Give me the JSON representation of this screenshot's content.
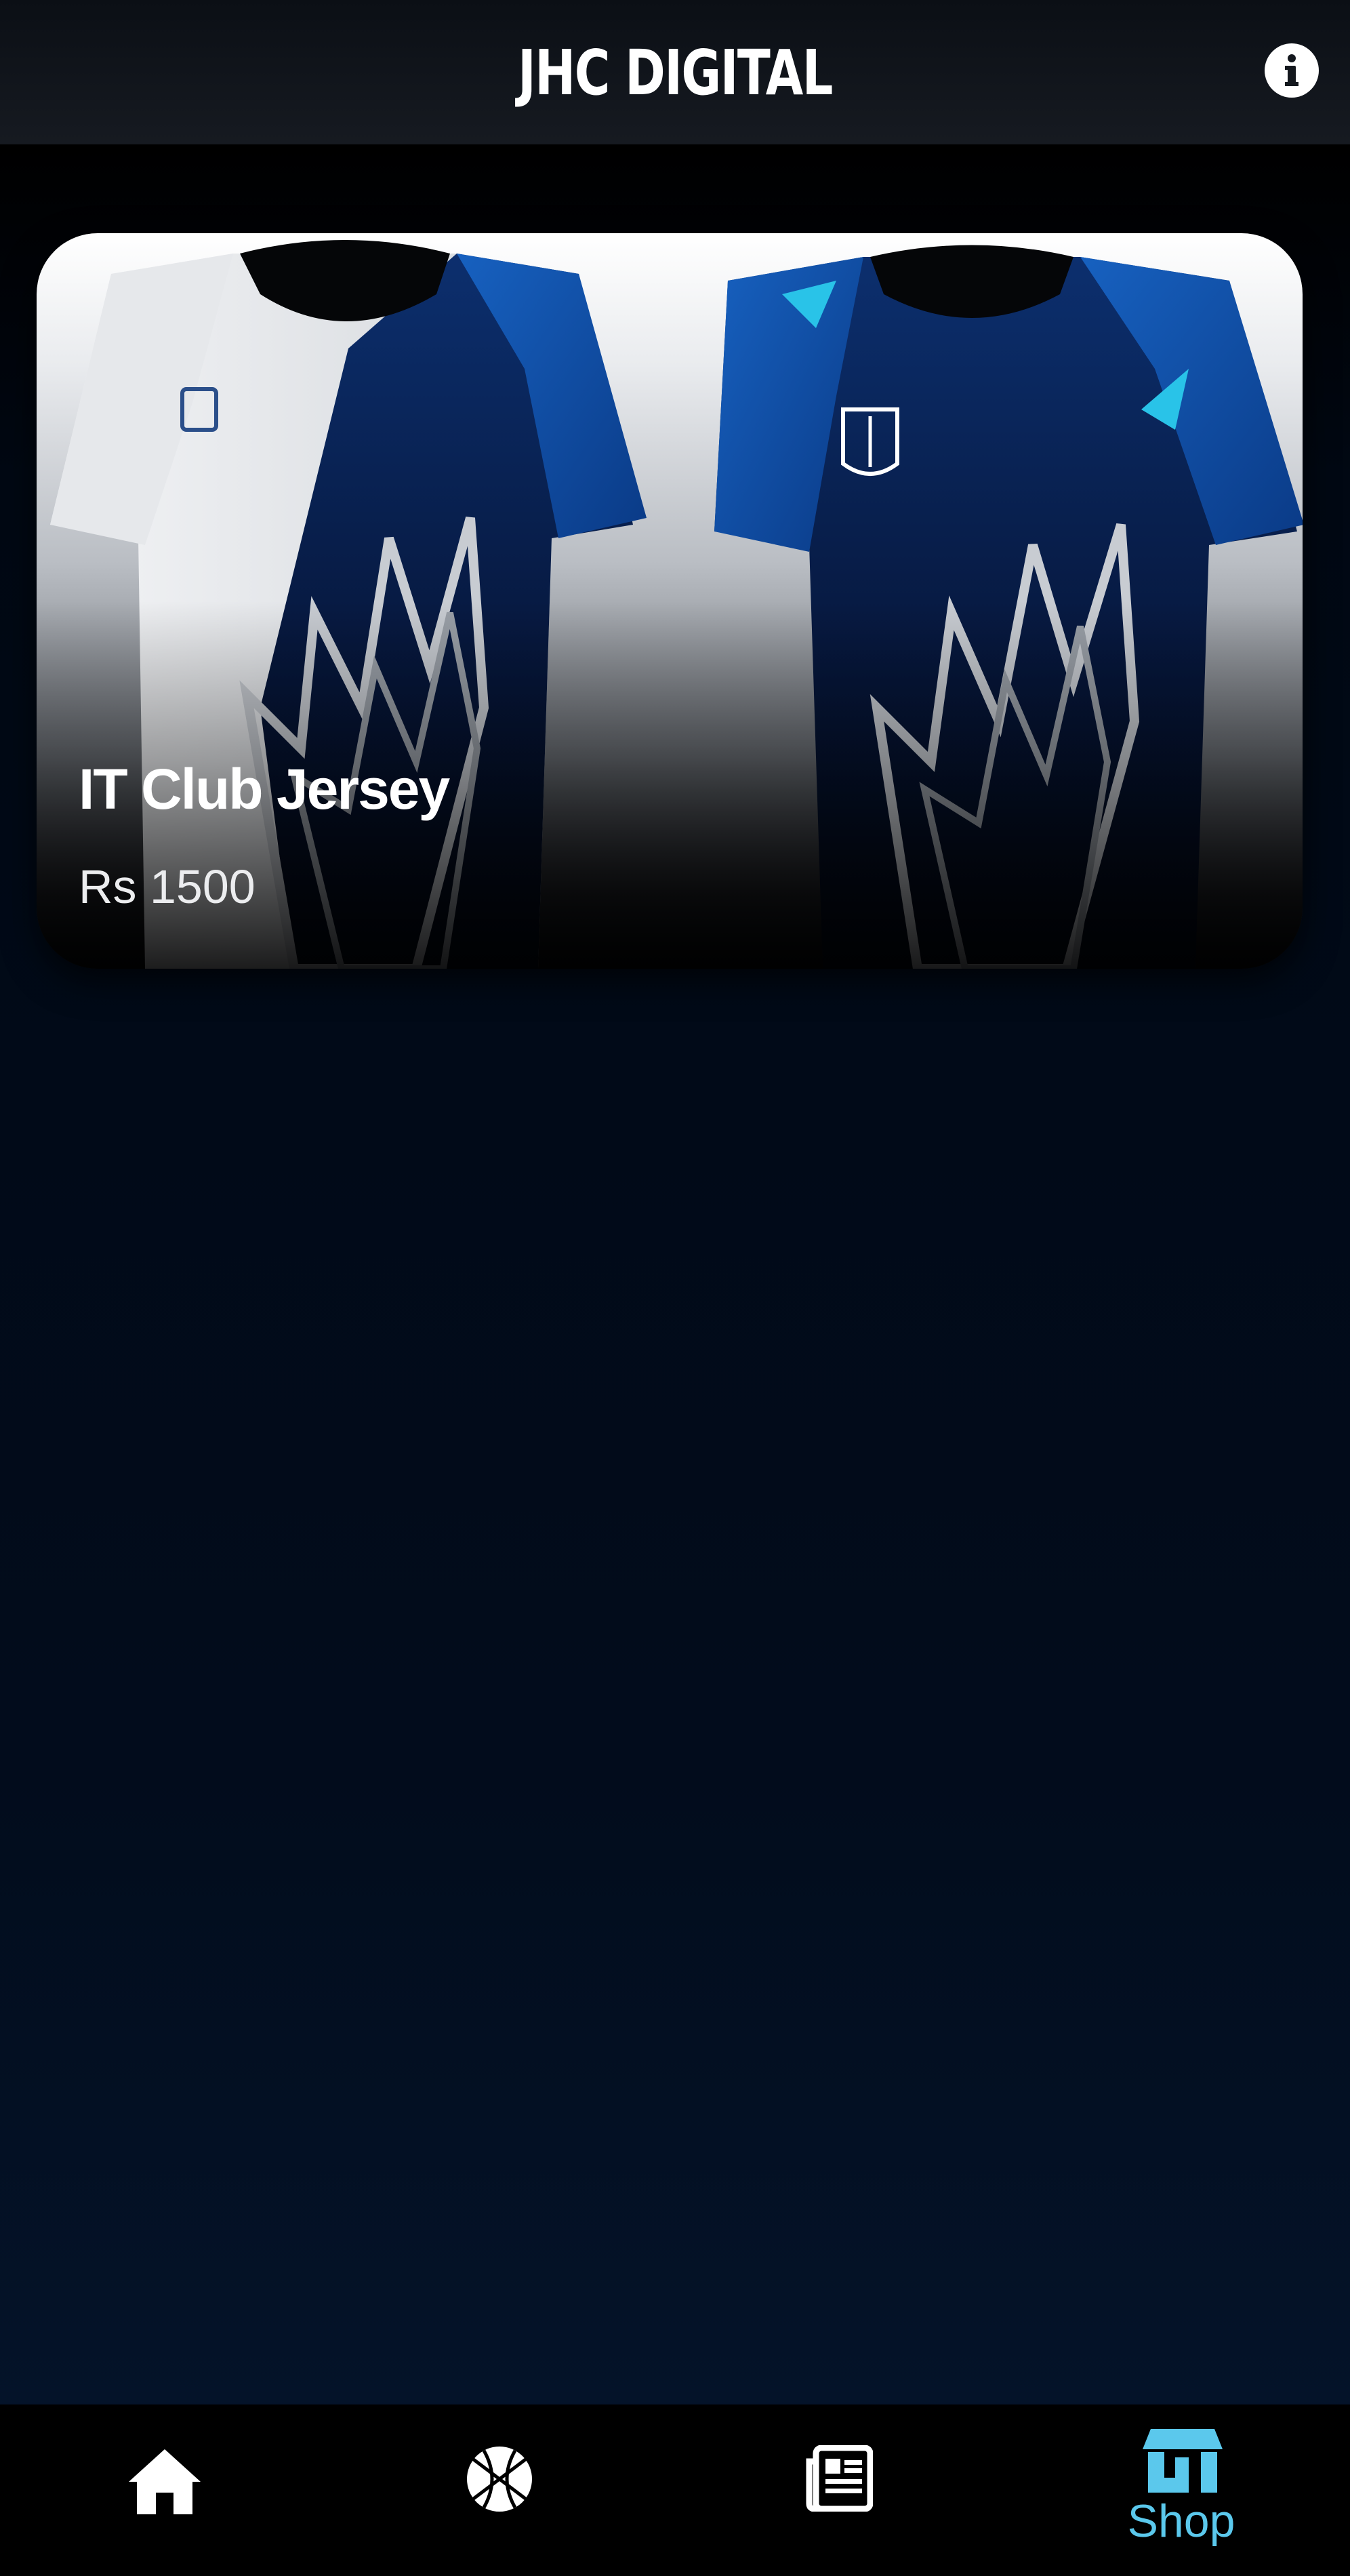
{
  "header": {
    "title": "JHC DIGITAL",
    "info_icon": "info-icon"
  },
  "product": {
    "name": "IT Club Jersey",
    "price": "Rs 1500"
  },
  "bottom_nav": {
    "items": [
      {
        "icon": "home-icon",
        "label": ""
      },
      {
        "icon": "basketball-icon",
        "label": ""
      },
      {
        "icon": "news-icon",
        "label": ""
      },
      {
        "icon": "shop-icon",
        "label": "Shop",
        "active": true
      }
    ],
    "active_color": "#5bc8ec"
  },
  "colors": {
    "background": "#000000",
    "header": "#14181e",
    "accent": "#5bc8ec",
    "jersey_blue": "#0d4f9e"
  }
}
